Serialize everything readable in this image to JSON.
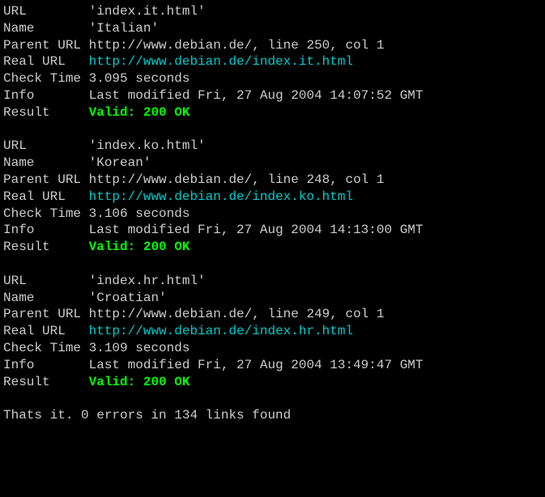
{
  "entries": [
    {
      "url_label": "URL        ",
      "url": "'index.it.html'",
      "name_label": "Name       ",
      "name": "'Italian'",
      "parent_label": "Parent URL ",
      "parent": "http://www.debian.de/, line 250, col 1",
      "realurl_label": "Real URL   ",
      "realurl": "http://www.debian.de/index.it.html",
      "check_label": "Check Time ",
      "check": "3.095 seconds",
      "info_label": "Info       ",
      "info": "Last modified Fri, 27 Aug 2004 14:07:52 GMT",
      "result_label": "Result     ",
      "result": "Valid: 200 OK"
    },
    {
      "url_label": "URL        ",
      "url": "'index.ko.html'",
      "name_label": "Name       ",
      "name": "'Korean'",
      "parent_label": "Parent URL ",
      "parent": "http://www.debian.de/, line 248, col 1",
      "realurl_label": "Real URL   ",
      "realurl": "http://www.debian.de/index.ko.html",
      "check_label": "Check Time ",
      "check": "3.106 seconds",
      "info_label": "Info       ",
      "info": "Last modified Fri, 27 Aug 2004 14:13:00 GMT",
      "result_label": "Result     ",
      "result": "Valid: 200 OK"
    },
    {
      "url_label": "URL        ",
      "url": "'index.hr.html'",
      "name_label": "Name       ",
      "name": "'Croatian'",
      "parent_label": "Parent URL ",
      "parent": "http://www.debian.de/, line 249, col 1",
      "realurl_label": "Real URL   ",
      "realurl": "http://www.debian.de/index.hr.html",
      "check_label": "Check Time ",
      "check": "3.109 seconds",
      "info_label": "Info       ",
      "info": "Last modified Fri, 27 Aug 2004 13:49:47 GMT",
      "result_label": "Result     ",
      "result": "Valid: 200 OK"
    }
  ],
  "summary": "Thats it. 0 errors in 134 links found"
}
